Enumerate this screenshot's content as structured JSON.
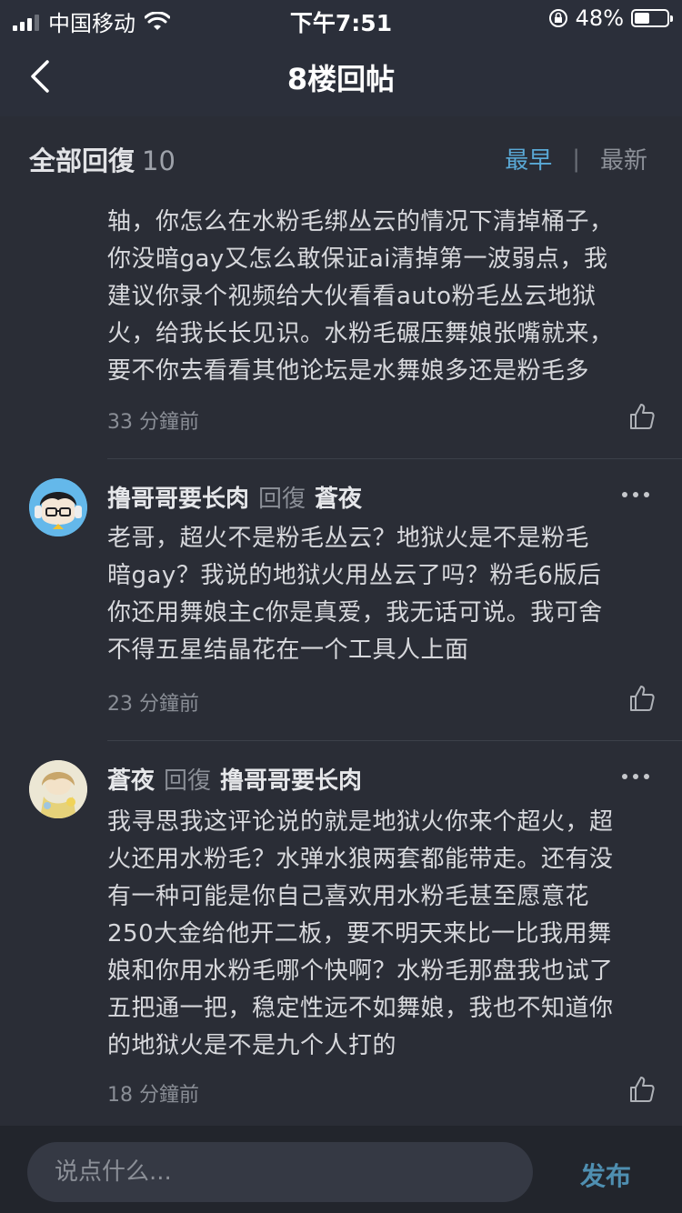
{
  "status": {
    "carrier": "中国移动",
    "time": "下午7:51",
    "battery": "48%"
  },
  "nav": {
    "title": "8楼回帖"
  },
  "section": {
    "label": "全部回復",
    "count": "10",
    "sort_earliest": "最早",
    "sort_latest": "最新"
  },
  "comments": [
    {
      "text_lines": [
        "轴，你怎么在水粉毛绑丛云的情况下清掉桶子，",
        "你没暗gay又怎么敢保证ai清掉第一波弱点，我",
        "建议你录个视频给大伙看看auto粉毛丛云地狱",
        "火，给我长长见识。水粉毛碾压舞娘张嘴就来，",
        "要不你去看看其他论坛是水舞娘多还是粉毛多"
      ],
      "time": "33 分鐘前"
    },
    {
      "author": "撸哥哥要长肉",
      "reply_word": "回復",
      "reply_to": "蒼夜",
      "text_lines": [
        "老哥，超火不是粉毛丛云？地狱火是不是粉毛",
        "暗gay？我说的地狱火用丛云了吗？粉毛6版后",
        "你还用舞娘主c你是真爱，我无话可说。我可舍",
        "不得五星结晶花在一个工具人上面"
      ],
      "time": "23 分鐘前"
    },
    {
      "author": "蒼夜",
      "reply_word": "回復",
      "reply_to": "撸哥哥要长肉",
      "text_lines": [
        "我寻思我这评论说的就是地狱火你来个超火，超",
        "火还用水粉毛？水弹水狼两套都能带走。还有没",
        "有一种可能是你自己喜欢用水粉毛甚至愿意花",
        "250大金给他开二板，要不明天来比一比我用舞",
        "娘和你用水粉毛哪个快啊？水粉毛那盘我也试了",
        "五把通一把，稳定性远不如舞娘，我也不知道你",
        "的地狱火是不是九个人打的"
      ],
      "time": "18 分鐘前"
    }
  ],
  "input": {
    "placeholder": "说点什么..."
  },
  "publish_label": "发布"
}
